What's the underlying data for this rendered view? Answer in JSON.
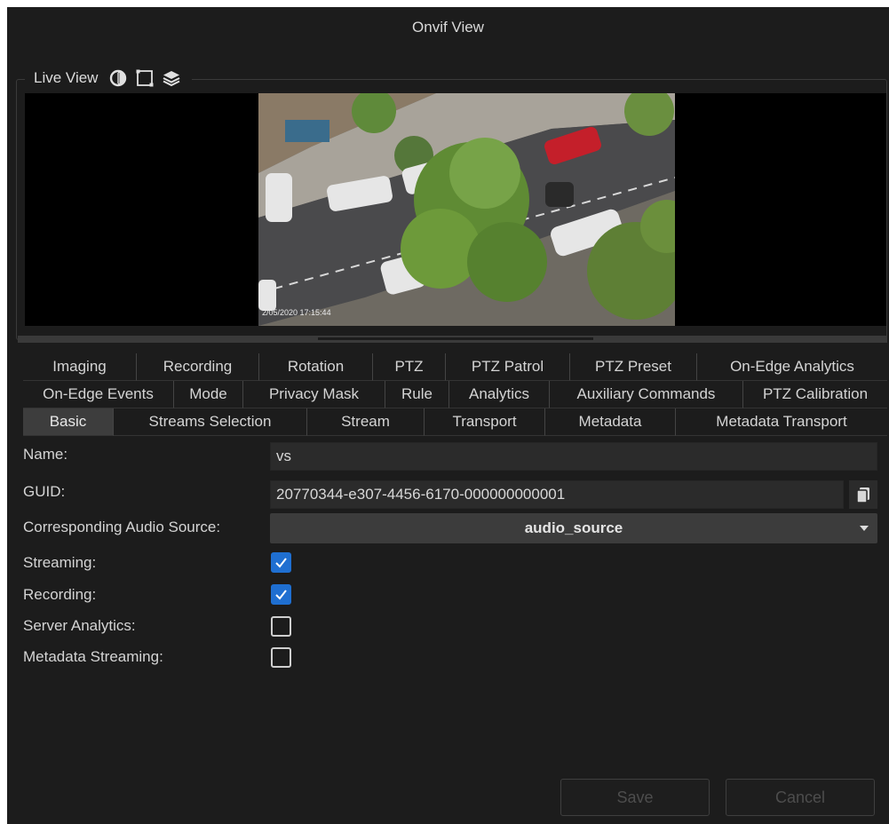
{
  "window": {
    "title": "Onvif View"
  },
  "live_view": {
    "label": "Live View",
    "icons": [
      "brightness-icon",
      "frame-icon",
      "layers-icon"
    ],
    "video_timestamp": "2/05/2020 17:15:44"
  },
  "tabs": {
    "row1": [
      "Imaging",
      "Recording",
      "Rotation",
      "PTZ",
      "PTZ Patrol",
      "PTZ Preset",
      "On-Edge Analytics"
    ],
    "row2": [
      "On-Edge Events",
      "Mode",
      "Privacy Mask",
      "Rule",
      "Analytics",
      "Auxiliary Commands",
      "PTZ Calibration"
    ],
    "row3": [
      "Basic",
      "Streams Selection",
      "Stream",
      "Transport",
      "Metadata",
      "Metadata Transport"
    ],
    "active": "Basic"
  },
  "form": {
    "name_label": "Name:",
    "name_value": "vs",
    "guid_label": "GUID:",
    "guid_value": "20770344-e307-4456-6170-000000000001",
    "audio_label": "Corresponding Audio Source:",
    "audio_value": "audio_source",
    "streaming_label": "Streaming:",
    "streaming_checked": true,
    "recording_label": "Recording:",
    "recording_checked": true,
    "server_analytics_label": "Server Analytics:",
    "server_analytics_checked": false,
    "metadata_streaming_label": "Metadata Streaming:",
    "metadata_streaming_checked": false
  },
  "buttons": {
    "save": "Save",
    "cancel": "Cancel"
  },
  "colors": {
    "accent": "#1f6fd1",
    "background": "#1c1c1c",
    "active_tab": "#3d3d3d"
  }
}
